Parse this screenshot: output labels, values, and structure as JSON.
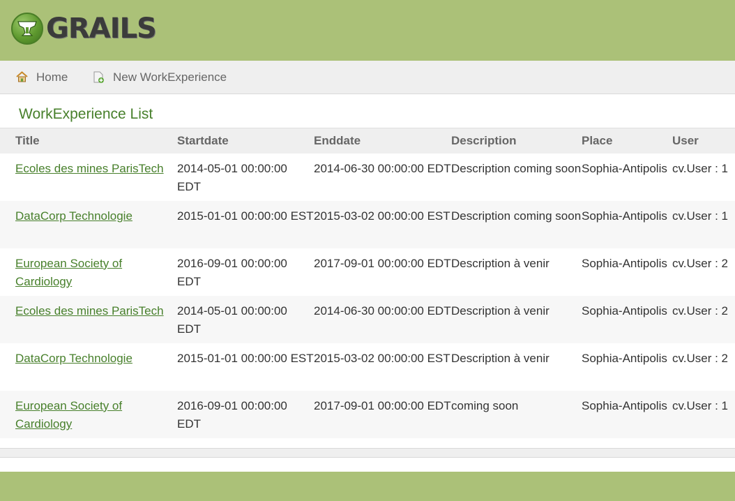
{
  "app": {
    "logo_text": "GRAILS",
    "header_color": "#abc178",
    "accent_color": "#48802c"
  },
  "nav": {
    "home_label": "Home",
    "home_icon": "home-icon",
    "new_label": "New WorkExperience",
    "new_icon": "new-document-icon"
  },
  "page": {
    "title": "WorkExperience List"
  },
  "table": {
    "columns": [
      "Title",
      "Startdate",
      "Enddate",
      "Description",
      "Place",
      "User"
    ],
    "rows": [
      {
        "title": "Ecoles des mines ParisTech",
        "startdate": "2014-05-01 00:00:00 EDT",
        "enddate": "2014-06-30 00:00:00 EDT",
        "description": "Description coming soon",
        "place": "Sophia-Antipolis",
        "user": "cv.User : 1"
      },
      {
        "title": "DataCorp Technologie",
        "startdate": "2015-01-01 00:00:00 EST",
        "enddate": "2015-03-02 00:00:00 EST",
        "description": "Description coming soon",
        "place": "Sophia-Antipolis",
        "user": "cv.User : 1"
      },
      {
        "title": "European Society of Cardiology",
        "startdate": "2016-09-01 00:00:00 EDT",
        "enddate": "2017-09-01 00:00:00 EDT",
        "description": "Description à venir",
        "place": "Sophia-Antipolis",
        "user": "cv.User : 2"
      },
      {
        "title": "Ecoles des mines ParisTech",
        "startdate": "2014-05-01 00:00:00 EDT",
        "enddate": "2014-06-30 00:00:00 EDT",
        "description": "Description à venir",
        "place": "Sophia-Antipolis",
        "user": "cv.User : 2"
      },
      {
        "title": "DataCorp Technologie",
        "startdate": "2015-01-01 00:00:00 EST",
        "enddate": "2015-03-02 00:00:00 EST",
        "description": "Description à venir",
        "place": "Sophia-Antipolis",
        "user": "cv.User : 2"
      },
      {
        "title": "European Society of Cardiology",
        "startdate": "2016-09-01 00:00:00 EDT",
        "enddate": "2017-09-01 00:00:00 EDT",
        "description": "coming soon",
        "place": "Sophia-Antipolis",
        "user": "cv.User : 1"
      }
    ]
  }
}
